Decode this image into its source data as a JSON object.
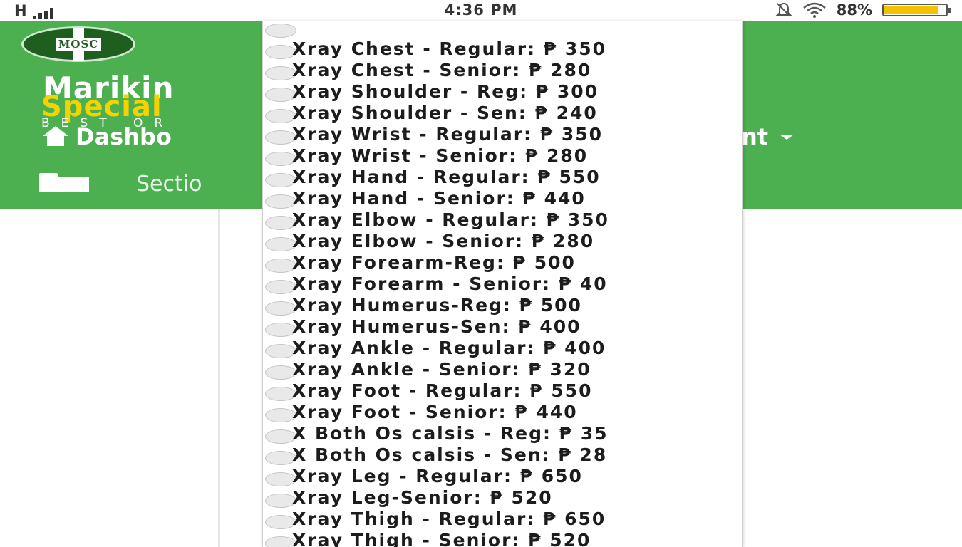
{
  "status_bar": {
    "network": "H",
    "time": "4:36 PM",
    "battery_percent": "88%",
    "battery_level": 0.88,
    "icons": [
      "signal-icon",
      "bell-muted-icon",
      "wifi-icon",
      "battery-icon"
    ]
  },
  "header": {
    "logo_text": "MOSC",
    "brand_line1": "Marikin",
    "brand_line2": "Special",
    "brand_tagline": "BEST OR",
    "nav_dashboard": "Dashbo",
    "nav_right": "nt",
    "nav_section": "Sectio",
    "colors": {
      "header_bg": "#4caf50",
      "brand_yellow": "#f5d300"
    }
  },
  "dropdown": {
    "options": [
      "Xray Chest - Regular: ₱ 350",
      "Xray Chest - Senior: ₱ 280",
      "Xray Shoulder - Reg: ₱ 300",
      "Xray Shoulder - Sen: ₱ 240",
      "Xray Wrist - Regular: ₱ 350",
      "Xray Wrist - Senior: ₱ 280",
      "Xray Hand - Regular: ₱ 550",
      "Xray Hand - Senior: ₱ 440",
      "Xray Elbow - Regular: ₱ 350",
      "Xray Elbow - Senior: ₱ 280",
      "Xray Forearm-Reg: ₱ 500",
      "Xray Forearm - Senior: ₱ 40",
      "Xray Humerus-Reg: ₱ 500",
      "Xray Humerus-Sen: ₱ 400",
      "Xray Ankle - Regular: ₱ 400",
      "Xray Ankle - Senior: ₱ 320",
      "Xray Foot - Regular: ₱ 550",
      "Xray Foot - Senior: ₱ 440",
      "X Both Os calsis - Reg: ₱ 35",
      "X Both Os calsis - Sen: ₱ 28",
      "Xray Leg - Regular: ₱ 650",
      "Xray Leg-Senior: ₱ 520",
      "Xray Thigh - Regular: ₱ 650",
      "Xray Thigh - Senior: ₱ 520"
    ]
  }
}
